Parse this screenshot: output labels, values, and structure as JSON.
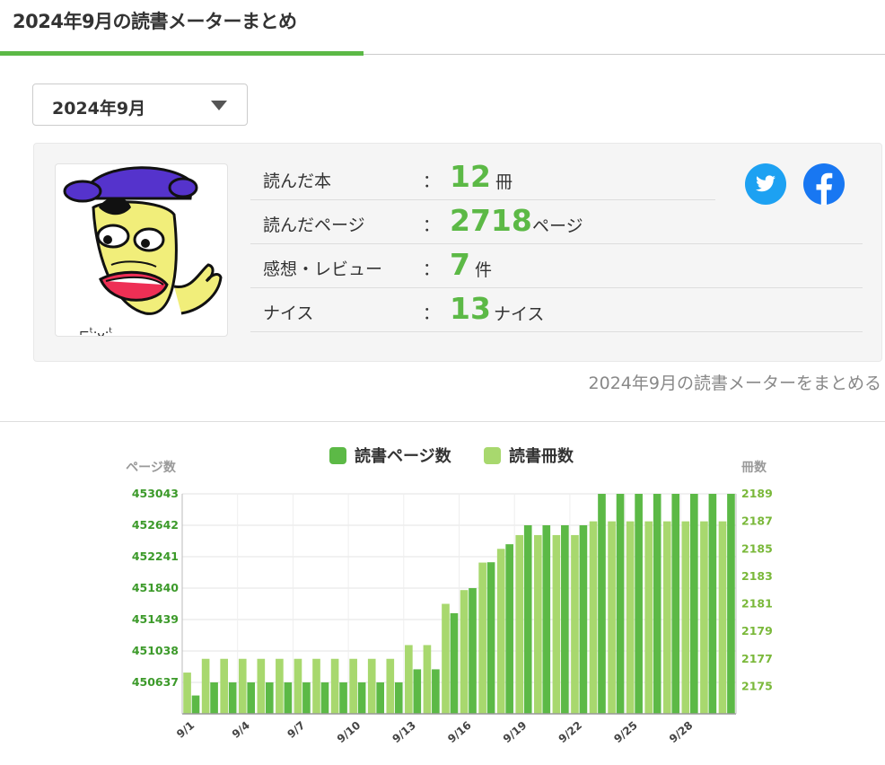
{
  "header": {
    "title": "2024年9月の読書メーターまとめ"
  },
  "month_select": {
    "value": "2024年9月",
    "icon": "triangle-down"
  },
  "summary": {
    "stats": [
      {
        "label": "読んだ本",
        "colon": "：",
        "value": "12",
        "unit": "冊"
      },
      {
        "label": "読んだページ",
        "colon": "：",
        "value": "2718",
        "unit": "ページ"
      },
      {
        "label": "感想・レビュー",
        "colon": "：",
        "value": "7",
        "unit": "件"
      },
      {
        "label": "ナイス",
        "colon": "：",
        "value": "13",
        "unit": "ナイス"
      }
    ],
    "share": [
      {
        "name": "twitter",
        "icon": "twitter-bird",
        "color": "#1da1f2"
      },
      {
        "name": "facebook",
        "icon": "facebook-f",
        "color": "#1877f2"
      }
    ],
    "summarize_link": "2024年9月の読書メーターをまとめる"
  },
  "colors": {
    "accent": "#5cb946",
    "pages_series": "#5cb946",
    "books_series": "#a8d86e"
  },
  "chart_data": {
    "type": "bar",
    "legend_position": "top-center",
    "grid": true,
    "x": [
      "9/1",
      "9/2",
      "9/3",
      "9/4",
      "9/5",
      "9/6",
      "9/7",
      "9/8",
      "9/9",
      "9/10",
      "9/11",
      "9/12",
      "9/13",
      "9/14",
      "9/15",
      "9/16",
      "9/17",
      "9/18",
      "9/19",
      "9/20",
      "9/21",
      "9/22",
      "9/23",
      "9/24",
      "9/25",
      "9/26",
      "9/27",
      "9/28",
      "9/29",
      "9/30"
    ],
    "x_tick_labels": [
      "9/1",
      "9/4",
      "9/7",
      "9/10",
      "9/13",
      "9/16",
      "9/19",
      "9/22",
      "9/25",
      "9/28"
    ],
    "y_left": {
      "label": "ページ数",
      "ticks": [
        450637,
        451038,
        451439,
        451840,
        452241,
        452642,
        453043
      ],
      "range": [
        450236,
        453043
      ]
    },
    "y_right": {
      "label": "冊数",
      "ticks": [
        2175,
        2177,
        2179,
        2181,
        2183,
        2185,
        2187,
        2189
      ],
      "range": [
        2173,
        2189
      ]
    },
    "series": [
      {
        "name": "読書ページ数",
        "axis": "left",
        "values": [
          450470,
          450637,
          450637,
          450637,
          450637,
          450637,
          450637,
          450637,
          450637,
          450637,
          450637,
          450637,
          450804,
          450804,
          451520,
          451840,
          452170,
          452400,
          452642,
          452642,
          452642,
          452642,
          453043,
          453043,
          453043,
          453043,
          453043,
          453043,
          453043,
          453043
        ]
      },
      {
        "name": "読書冊数",
        "axis": "right",
        "values": [
          2176,
          2177,
          2177,
          2177,
          2177,
          2177,
          2177,
          2177,
          2177,
          2177,
          2177,
          2177,
          2178,
          2178,
          2181,
          2182,
          2184,
          2185,
          2186,
          2186,
          2186,
          2186,
          2187,
          2187,
          2187,
          2187,
          2187,
          2187,
          2187,
          2187
        ]
      }
    ]
  }
}
